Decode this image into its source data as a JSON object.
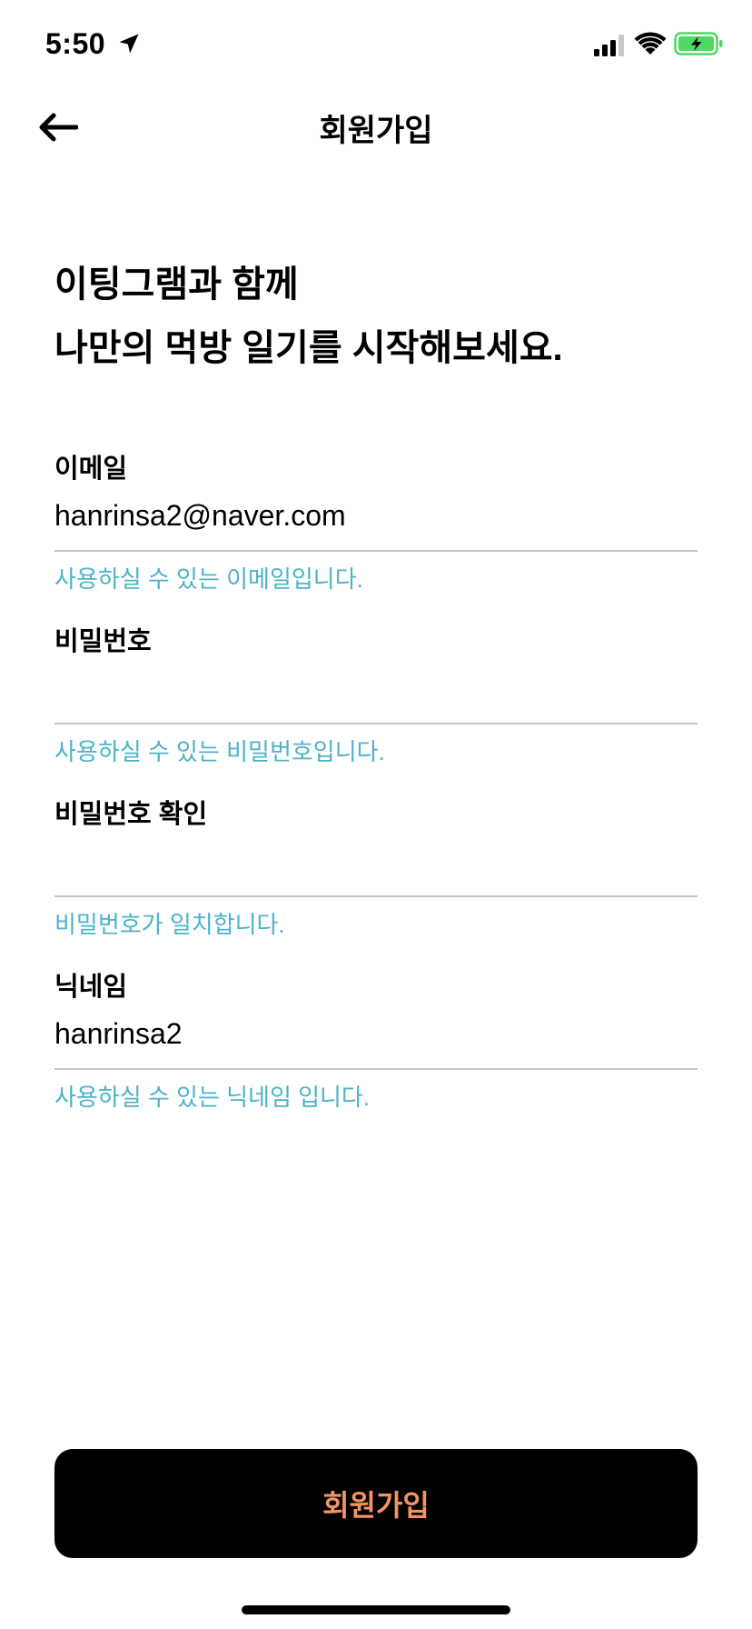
{
  "status_bar": {
    "time": "5:50",
    "icons": [
      "location-arrow-icon",
      "cellular-signal-icon",
      "wifi-icon",
      "battery-charging-icon"
    ],
    "battery_color": "#4cd964"
  },
  "nav": {
    "back_icon": "arrow-left-icon",
    "title": "회원가입"
  },
  "heading": {
    "line1": "이팅그램과 함께",
    "line2": "나만의 먹방 일기를 시작해보세요."
  },
  "form": {
    "email": {
      "label": "이메일",
      "value": "hanrinsa2@naver.com",
      "hint": "사용하실 수 있는 이메일입니다."
    },
    "password": {
      "label": "비밀번호",
      "value": "",
      "hint": "사용하실 수 있는 비밀번호입니다."
    },
    "password_confirm": {
      "label": "비밀번호 확인",
      "value": "",
      "hint": "비밀번호가 일치합니다."
    },
    "nickname": {
      "label": "닉네임",
      "value": "hanrinsa2",
      "hint": "사용하실 수 있는 닉네임 입니다."
    }
  },
  "submit": {
    "label": "회원가입"
  },
  "colors": {
    "hint": "#4cb3c9",
    "button_bg": "#000000",
    "button_text": "#f29563",
    "divider": "#c6c6c6"
  }
}
